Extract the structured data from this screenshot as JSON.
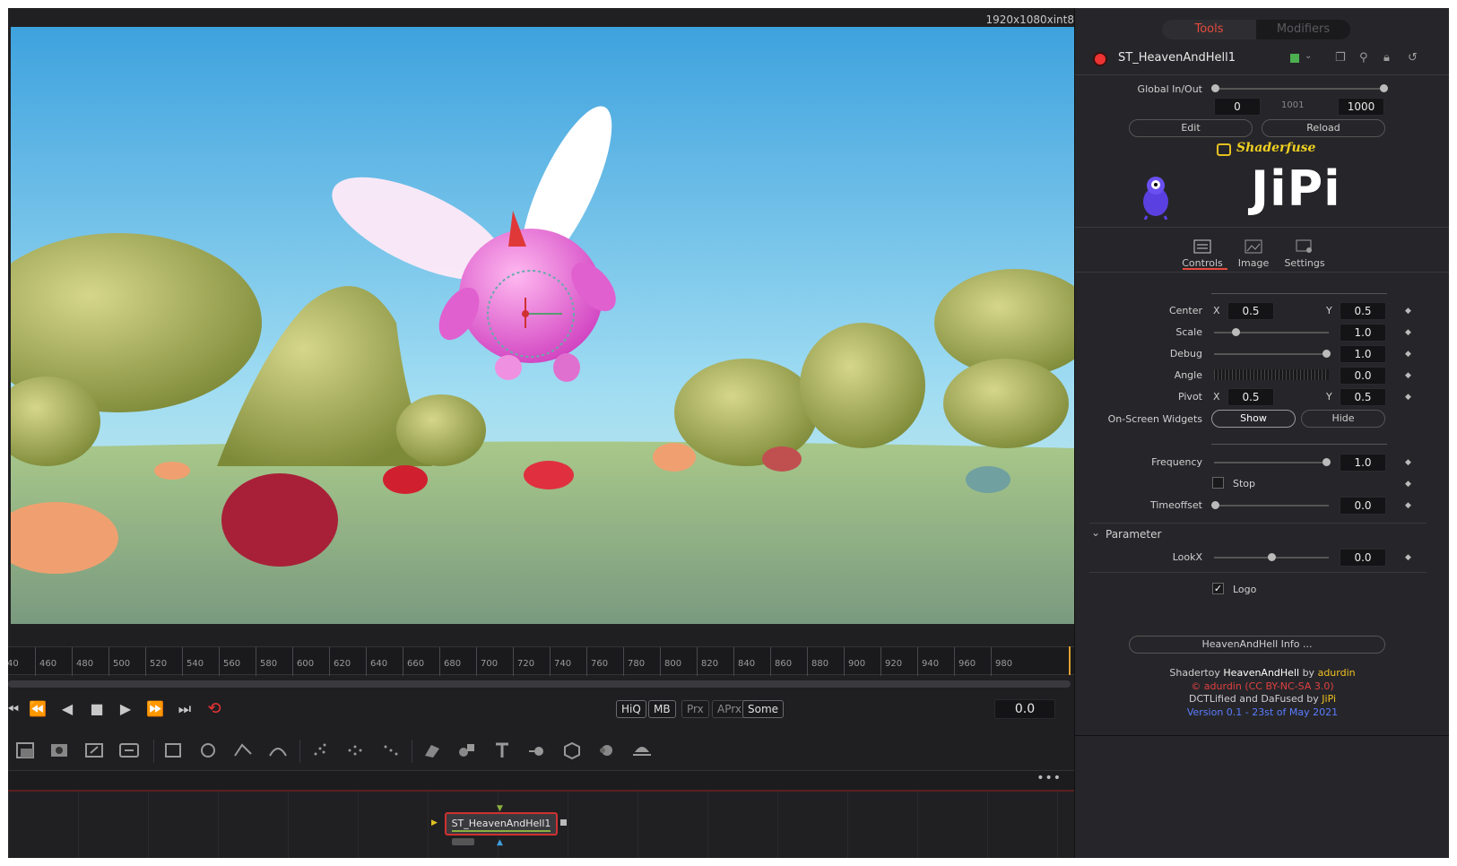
{
  "viewer": {
    "resolution": "1920x1080xint8"
  },
  "ruler": {
    "ticks": [
      "40",
      "460",
      "480",
      "500",
      "520",
      "540",
      "560",
      "580",
      "600",
      "620",
      "640",
      "660",
      "680",
      "700",
      "720",
      "740",
      "760",
      "780",
      "800",
      "820",
      "840",
      "860",
      "880",
      "900",
      "920",
      "940",
      "960",
      "980"
    ]
  },
  "transport": {
    "quality_buttons": [
      "HiQ",
      "MB",
      "Prx",
      "APrx",
      "Some"
    ],
    "current_time": "0.0"
  },
  "flow": {
    "node_name": "ST_HeavenAndHell1"
  },
  "panel": {
    "tabs": {
      "tools": "Tools",
      "modifiers": "Modifiers"
    },
    "tool_name": "ST_HeavenAndHell1",
    "global_inout": {
      "label": "Global In/Out",
      "start": "0",
      "mid": "1001",
      "end": "1000",
      "edit": "Edit",
      "reload": "Reload"
    },
    "brand": {
      "shaderfuse": "Shaderfuse",
      "author": "JiPi"
    },
    "subtabs": [
      "Controls",
      "Image",
      "Settings"
    ],
    "controls": {
      "center_label": "Center",
      "center_x": "0.5",
      "center_y": "0.5",
      "scale_label": "Scale",
      "scale": "1.0",
      "debug_label": "Debug",
      "debug": "1.0",
      "angle_label": "Angle",
      "angle": "0.0",
      "pivot_label": "Pivot",
      "pivot_x": "0.5",
      "pivot_y": "0.5",
      "widgets_label": "On-Screen Widgets",
      "show": "Show",
      "hide": "Hide",
      "frequency_label": "Frequency",
      "frequency": "1.0",
      "stop_label": "Stop",
      "timeoffset_label": "Timeoffset",
      "timeoffset": "0.0",
      "parameter_label": "Parameter",
      "lookx_label": "LookX",
      "lookx": "0.0",
      "logo_label": "Logo",
      "x_letter": "X",
      "y_letter": "Y"
    },
    "info_button": "HeavenAndHell Info ...",
    "credits": {
      "line1_a": "Shadertoy ",
      "line1_b": "HeavenAndHell",
      "line1_c": " by ",
      "line1_d": "adurdin",
      "line2": "© adurdin (CC BY-NC-SA 3.0)",
      "line3_a": "DCTLified and DaFused by ",
      "line3_b": "JiPi",
      "line4": "Version 0.1 - 23st of May 2021"
    },
    "colors": {
      "accent_red": "#e64a3c",
      "credit_yellow": "#f0c020",
      "credit_red": "#e04040",
      "credit_blue": "#5a7cff"
    }
  }
}
